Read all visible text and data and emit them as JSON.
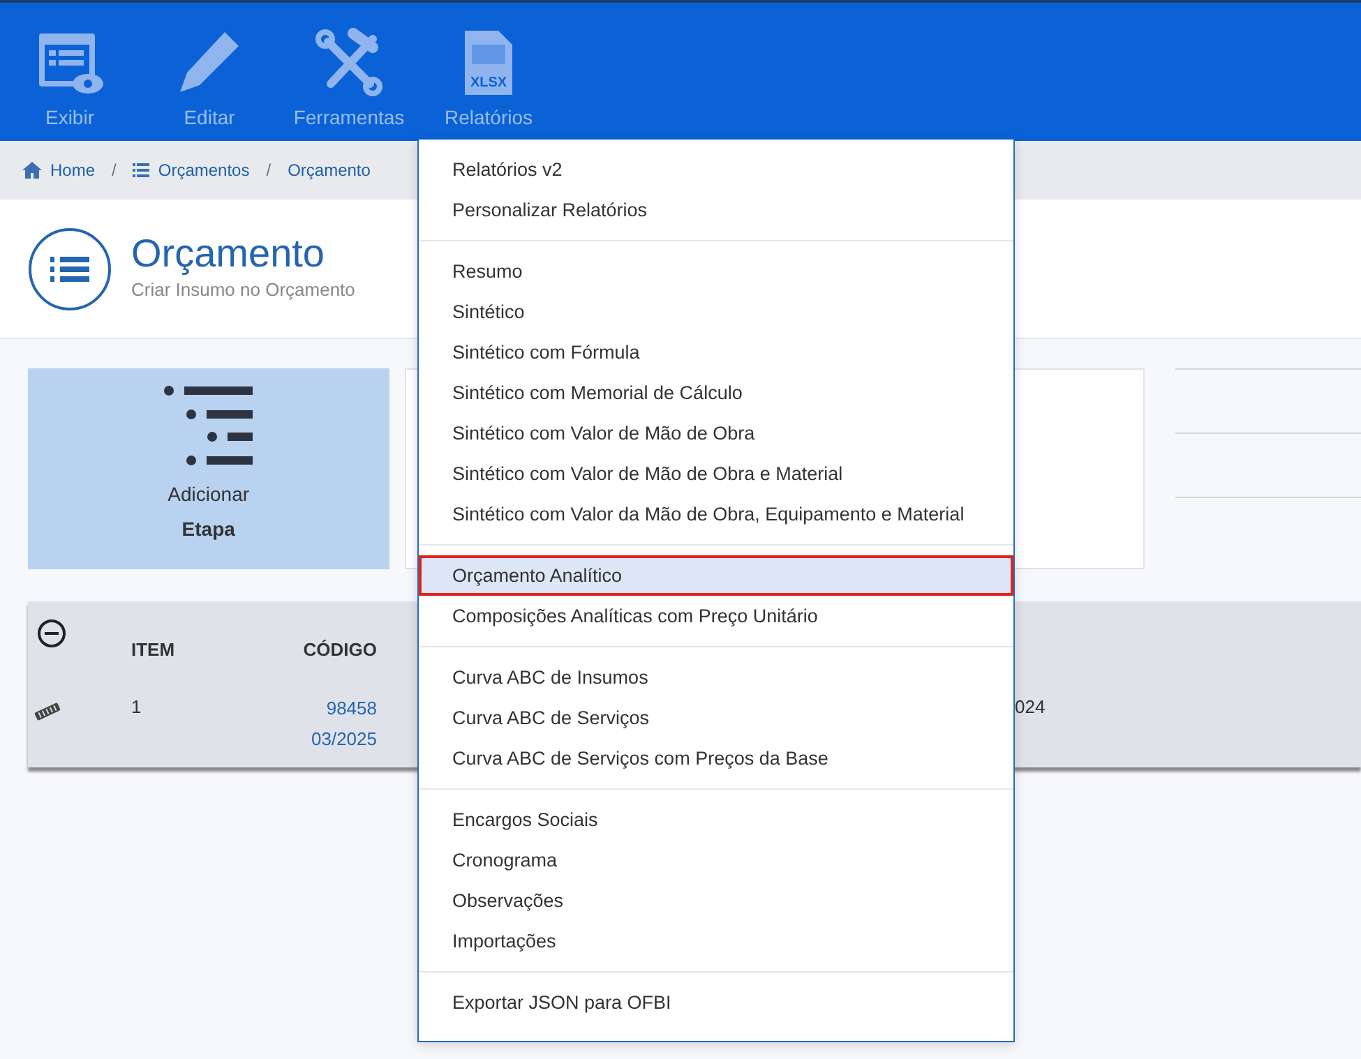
{
  "toolbar": [
    {
      "label": "Exibir",
      "kind": "view"
    },
    {
      "label": "Editar",
      "kind": "edit"
    },
    {
      "label": "Ferramentas",
      "kind": "tools"
    },
    {
      "label": "Relatórios",
      "kind": "xlsx",
      "icon_text": "XLSX"
    }
  ],
  "breadcrumb": [
    {
      "label": "Home",
      "kind": "home"
    },
    {
      "separator": "/",
      "label": "Orçamentos",
      "kind": "list"
    },
    {
      "separator": "/",
      "label": "Orçamento",
      "kind": "plain"
    }
  ],
  "header": {
    "title": "Orçamento",
    "subtitle": "Criar Insumo no Orçamento"
  },
  "cards": [
    {
      "label": "Adicionar",
      "strong": "Etapa"
    }
  ],
  "table": {
    "columns": [
      "ITEM",
      "CÓDIGO"
    ],
    "rows": [
      {
        "item": "1",
        "code": "98458",
        "code_date": "03/2025",
        "column_5": "024"
      }
    ]
  },
  "menu": {
    "groups": [
      {
        "items": [
          {
            "label": "Relatórios v2",
            "selected": false
          },
          {
            "label": "Personalizar Relatórios",
            "selected": false
          }
        ]
      },
      {
        "items": [
          {
            "label": "Resumo",
            "selected": false
          },
          {
            "label": "Sintético",
            "selected": false
          },
          {
            "label": "Sintético com Fórmula",
            "selected": false
          },
          {
            "label": "Sintético com Memorial de Cálculo",
            "selected": false
          },
          {
            "label": "Sintético com Valor de Mão de Obra",
            "selected": false
          },
          {
            "label": "Sintético com Valor de Mão de Obra e Material",
            "selected": false
          },
          {
            "label": "Sintético com Valor da Mão de Obra, Equipamento e Material",
            "selected": false
          }
        ]
      },
      {
        "items": [
          {
            "label": "Orçamento Analítico",
            "selected": true
          },
          {
            "label": "Composições Analíticas com Preço Unitário",
            "selected": false
          }
        ]
      },
      {
        "items": [
          {
            "label": "Curva ABC de Insumos",
            "selected": false
          },
          {
            "label": "Curva ABC de Serviços",
            "selected": false
          },
          {
            "label": "Curva ABC de Serviços com Preços da Base",
            "selected": false
          }
        ]
      },
      {
        "items": [
          {
            "label": "Encargos Sociais",
            "selected": false
          },
          {
            "label": "Cronograma",
            "selected": false
          },
          {
            "label": "Observações",
            "selected": false
          },
          {
            "label": "Importações",
            "selected": false
          }
        ]
      },
      {
        "items": [
          {
            "label": "Exportar JSON para OFBI",
            "selected": false
          }
        ]
      }
    ]
  }
}
